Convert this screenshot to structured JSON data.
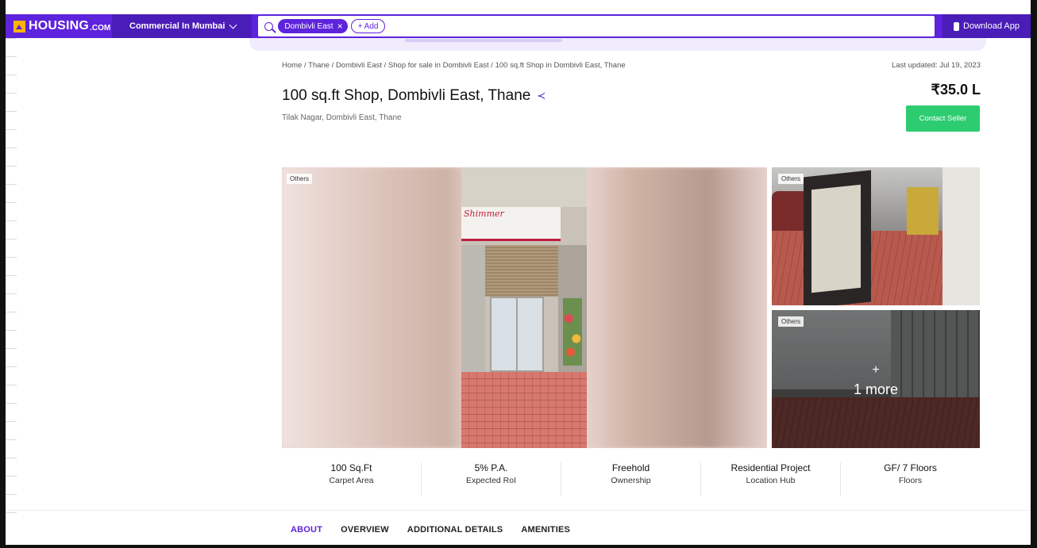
{
  "navbar": {
    "logo_text": "HOUSING",
    "logo_suffix": ".COM",
    "city_select": "Commercial In Mumbai",
    "search_chip": "Dombivli East",
    "add_chip": "+ Add",
    "download_app": "Download App",
    "brand_color": "#5e23dc"
  },
  "breadcrumb": "Home / Thane / Dombivli East / Shop for sale in Dombivli East / 100 sq.ft Shop in Dombivli East, Thane",
  "last_updated": "Last updated: Jul 19, 2023",
  "listing": {
    "title": "100 sq.ft Shop, Dombivli East, Thane",
    "locality": "Tilak Nagar, Dombivli East, Thane",
    "price": "₹35.0 L",
    "contact_button": "Contact Seller",
    "contact_color": "#2ecc71"
  },
  "gallery": {
    "main_tag": "Others",
    "main_sign": "Shimmer",
    "side1_tag": "Others",
    "side2_tag": "Others",
    "more_plus": "+",
    "more_label": "1 more"
  },
  "stats": [
    {
      "value": "100 Sq.Ft",
      "label": "Carpet Area"
    },
    {
      "value": "5% P.A.",
      "label": "Expected RoI"
    },
    {
      "value": "Freehold",
      "label": "Ownership"
    },
    {
      "value": "Residential Project",
      "label": "Location Hub"
    },
    {
      "value": "GF/ 7 Floors",
      "label": "Floors"
    }
  ],
  "tabs": [
    {
      "label": "ABOUT",
      "active": true
    },
    {
      "label": "OVERVIEW",
      "active": false
    },
    {
      "label": "ADDITIONAL DETAILS",
      "active": false
    },
    {
      "label": "AMENITIES",
      "active": false
    }
  ]
}
